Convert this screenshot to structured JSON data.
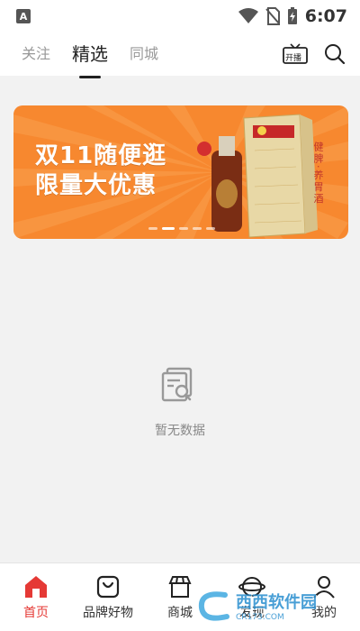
{
  "status_bar": {
    "app_badge": "A",
    "time": "6:07"
  },
  "top_nav": {
    "tabs": [
      {
        "label": "关注",
        "active": false
      },
      {
        "label": "精选",
        "active": true
      },
      {
        "label": "同城",
        "active": false
      }
    ],
    "tv_icon_label": "开播"
  },
  "banner": {
    "line1": "双11随便逛",
    "line2": "限量大优惠",
    "side_text": "健脾·养胃酒",
    "slide_count": 5,
    "active_slide": 2,
    "accent_color": "#f7882f"
  },
  "empty_state": {
    "label": "暂无数据"
  },
  "bottom_nav": {
    "items": [
      {
        "label": "首页",
        "icon": "home-icon",
        "active": true
      },
      {
        "label": "品牌好物",
        "icon": "bag-icon",
        "active": false
      },
      {
        "label": "商城",
        "icon": "store-icon",
        "active": false
      },
      {
        "label": "发现",
        "icon": "discover-icon",
        "active": false
      },
      {
        "label": "我的",
        "icon": "profile-icon",
        "active": false
      }
    ],
    "active_color": "#e53935"
  },
  "watermark": {
    "text": "西西软件园",
    "sub": "CR173.COM"
  }
}
